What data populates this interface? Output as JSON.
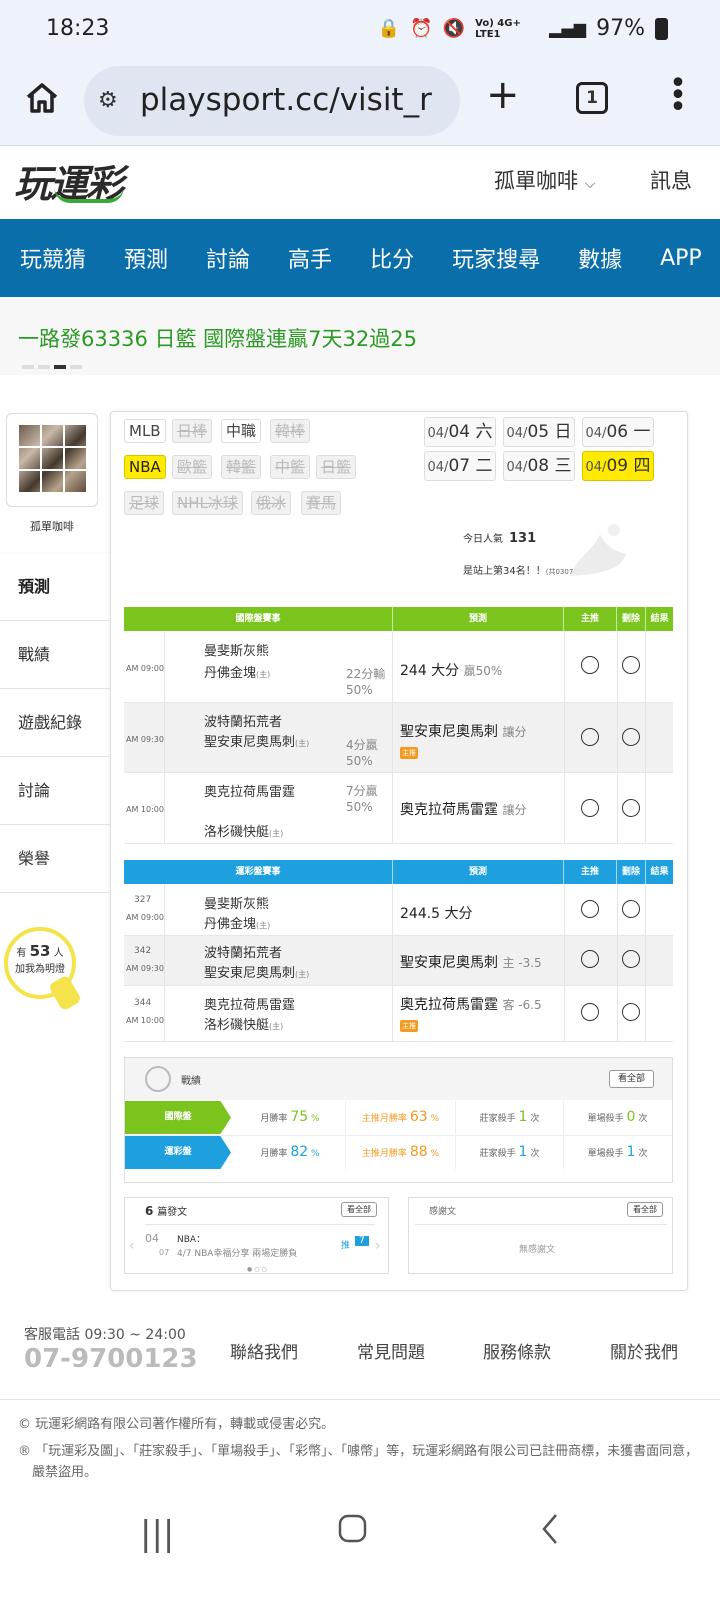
{
  "status": {
    "time": "18:23",
    "net": "Vo) 4G+ LTE1",
    "battery": "97%"
  },
  "browser": {
    "url": "playsport.cc/visit_r",
    "tab_count": "1"
  },
  "header": {
    "logo": "玩運彩",
    "user": "孤單咖啡",
    "user_caret": "⌵",
    "message": "訊息"
  },
  "nav": [
    "玩競猜",
    "預測",
    "討論",
    "高手",
    "比分",
    "玩家搜尋",
    "數據",
    "APP"
  ],
  "marquee": "一路發63336 日籃 國際盤連贏7天32過25",
  "profile": {
    "name": "孤單咖啡"
  },
  "side": [
    "預測",
    "戰績",
    "遊戲紀錄",
    "討論",
    "榮譽"
  ],
  "bulb": {
    "pre": "有",
    "count": "53",
    "unit": "人",
    "post": "加我為明燈"
  },
  "leagues": [
    {
      "label": "MLB",
      "state": "normal"
    },
    {
      "label": "日棒",
      "state": "disabled"
    },
    {
      "label": "中職",
      "state": "normal"
    },
    {
      "label": "韓棒",
      "state": "disabled"
    },
    {
      "label": "NBA",
      "state": "selected"
    },
    {
      "label": "歐籃",
      "state": "disabled"
    },
    {
      "label": "韓籃",
      "state": "disabled"
    },
    {
      "label": "中籃",
      "state": "disabled"
    },
    {
      "label": "日籃",
      "state": "disabled"
    },
    {
      "label": "足球",
      "state": "disabled"
    },
    {
      "label": "NHL冰球",
      "state": "disabled"
    },
    {
      "label": "俄冰",
      "state": "disabled"
    },
    {
      "label": "賽馬",
      "state": "disabled"
    }
  ],
  "dates": [
    {
      "m": "04/",
      "d": "04 六"
    },
    {
      "m": "04/",
      "d": "05 日"
    },
    {
      "m": "04/",
      "d": "06 一"
    },
    {
      "m": "04/",
      "d": "07 二"
    },
    {
      "m": "04/",
      "d": "08 三"
    },
    {
      "m": "04/",
      "d": "09 四"
    }
  ],
  "popularity": {
    "label": "今日人氣",
    "value": "131",
    "rank": "是站上第34名！！",
    "rank_note": "(共0307人)"
  },
  "intl": {
    "headers": [
      "國際盤賽事",
      "預測",
      "主推",
      "刪除",
      "結果"
    ],
    "rows": [
      {
        "time": "AM 09:00",
        "team1": "曼斐斯灰熊",
        "team2": "丹佛金塊",
        "home": "(主)",
        "odds1": "22分輸",
        "odds2": "50%",
        "pick": "244 大分",
        "pick_sub": "贏50%",
        "badge": ""
      },
      {
        "time": "AM 09:30",
        "team1": "波特蘭拓荒者",
        "team2": "聖安東尼奧馬刺",
        "home": "(主)",
        "odds1": "4分贏",
        "odds2": "50%",
        "pick": "聖安東尼奧馬刺",
        "pick_sub": "讓分",
        "badge": "主推"
      },
      {
        "time": "AM 10:00",
        "team1": "奧克拉荷馬雷霆",
        "team2": "洛杉磯快艇",
        "home": "(主)",
        "odds1": "7分贏",
        "odds2": "50%",
        "pick": "奧克拉荷馬雷霆",
        "pick_sub": "讓分",
        "badge": ""
      }
    ]
  },
  "lottery": {
    "headers": [
      "運彩盤賽事",
      "預測",
      "主推",
      "刪除",
      "結果"
    ],
    "rows": [
      {
        "no": "327",
        "time": "AM 09:00",
        "team1": "曼斐斯灰熊",
        "team2": "丹佛金塊",
        "home": "(主)",
        "pick": "244.5 大分",
        "pick_sub": "",
        "badge": ""
      },
      {
        "no": "342",
        "time": "AM 09:30",
        "team1": "波特蘭拓荒者",
        "team2": "聖安東尼奧馬刺",
        "home": "(主)",
        "pick": "聖安東尼奧馬刺",
        "pick_sub": "主 -3.5",
        "badge": ""
      },
      {
        "no": "344",
        "time": "AM 10:00",
        "team1": "奧克拉荷馬雷霆",
        "team2": "洛杉磯快艇",
        "home": "(主)",
        "pick": "奧克拉荷馬雷霆",
        "pick_sub": "客 -6.5",
        "badge": "主推"
      }
    ]
  },
  "record": {
    "title": "戰績",
    "view_all": "看全部",
    "rows": [
      {
        "label": "國際盤",
        "color": "#7bc41e",
        "win_label": "月勝率",
        "win": "75",
        "pct": "%",
        "main_label": "主推月勝率",
        "main": "63",
        "killer_label": "莊家殺手",
        "killer": "1",
        "killer_unit": "次",
        "single_label": "單場殺手",
        "single": "0",
        "single_unit": "次"
      },
      {
        "label": "運彩盤",
        "color": "#1ea0df",
        "win_label": "月勝率",
        "win": "82",
        "pct": "%",
        "main_label": "主推月勝率",
        "main": "88",
        "killer_label": "莊家殺手",
        "killer": "1",
        "killer_unit": "次",
        "single_label": "單場殺手",
        "single": "1",
        "single_unit": "次"
      }
    ]
  },
  "posts": {
    "count": "6",
    "label": "篇發文",
    "view_all": "看全部",
    "date_m": "04",
    "date_d": "07",
    "league": "NBA：",
    "title": "4/7 NBA幸福分享 兩場定勝負",
    "push_label": "推",
    "push": "7"
  },
  "thanks": {
    "title": "感謝文",
    "view_all": "看全部",
    "empty": "無感謝文"
  },
  "footer": {
    "hours": "客服電話 09:30 ~ 24:00",
    "phone": "07-9700123",
    "links": [
      "聯絡我們",
      "常見問題",
      "服務條款",
      "關於我們"
    ],
    "copy1": "© 玩運彩網路有限公司著作權所有，轉載或侵害必究。",
    "copy2": "® 「玩運彩及圖」、「莊家殺手」、「單場殺手」、「彩幣」、「噱幣」等，玩運彩網路有限公司已註冊商標，未獲書面同意，嚴禁盜用。"
  },
  "colors": {
    "nav": "#0a6eab",
    "intl": "#7bc41e",
    "lottery": "#1ea0df",
    "marquee": "#2b9a24",
    "selected": "#ffea00"
  }
}
